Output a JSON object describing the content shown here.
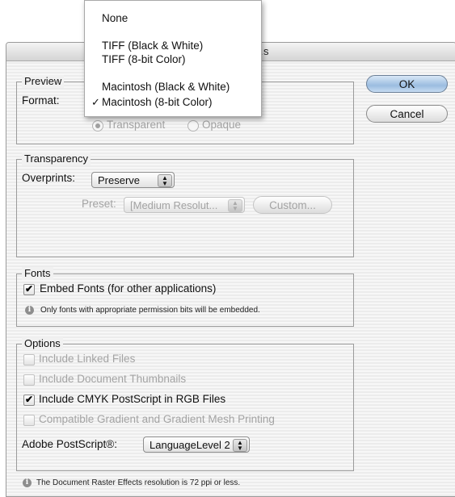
{
  "dialog": {
    "title": "…s",
    "ok_label": "OK",
    "cancel_label": "Cancel"
  },
  "format_menu": {
    "items": [
      {
        "label": "None"
      },
      {
        "label": "TIFF (Black & White)"
      },
      {
        "label": "TIFF (8-bit Color)"
      },
      {
        "label": "Macintosh (Black & White)"
      },
      {
        "label": "Macintosh (8-bit Color)",
        "checked": true,
        "check_glyph": "✓"
      }
    ]
  },
  "preview": {
    "legend": "Preview",
    "format_label": "Format:",
    "transparent_label": "Transparent",
    "opaque_label": "Opaque",
    "selected": "Transparent"
  },
  "transparency": {
    "legend": "Transparency",
    "overprints_label": "Overprints:",
    "overprints_value": "Preserve",
    "preset_label": "Preset:",
    "preset_value": "[Medium Resolut...",
    "custom_label": "Custom..."
  },
  "fonts": {
    "legend": "Fonts",
    "embed_label": "Embed Fonts (for other applications)",
    "embed_checked": true,
    "note": "Only fonts with appropriate permission bits will be embedded."
  },
  "options": {
    "legend": "Options",
    "items": [
      {
        "label": "Include Linked Files",
        "checked": false,
        "enabled": false
      },
      {
        "label": "Include Document Thumbnails",
        "checked": false,
        "enabled": false
      },
      {
        "label": "Include CMYK PostScript in RGB Files",
        "checked": true,
        "enabled": true
      },
      {
        "label": "Compatible Gradient and Gradient Mesh Printing",
        "checked": false,
        "enabled": false
      }
    ],
    "postscript_label": "Adobe PostScript®:",
    "postscript_value": "LanguageLevel 2"
  },
  "footer": {
    "note": "The Document Raster Effects resolution is 72 ppi or less."
  },
  "glyphs": {
    "check": "✓",
    "checkbox_mark": "✔",
    "info": "i",
    "popup_arrows": "▲▼"
  },
  "icons": [
    "info-icon",
    "popup-arrows-icon",
    "checkmark-icon"
  ],
  "colors": {
    "default_button": "#9bbce0",
    "disabled_text": "#a3a3a3",
    "dialog_stripe": "#ececec"
  }
}
